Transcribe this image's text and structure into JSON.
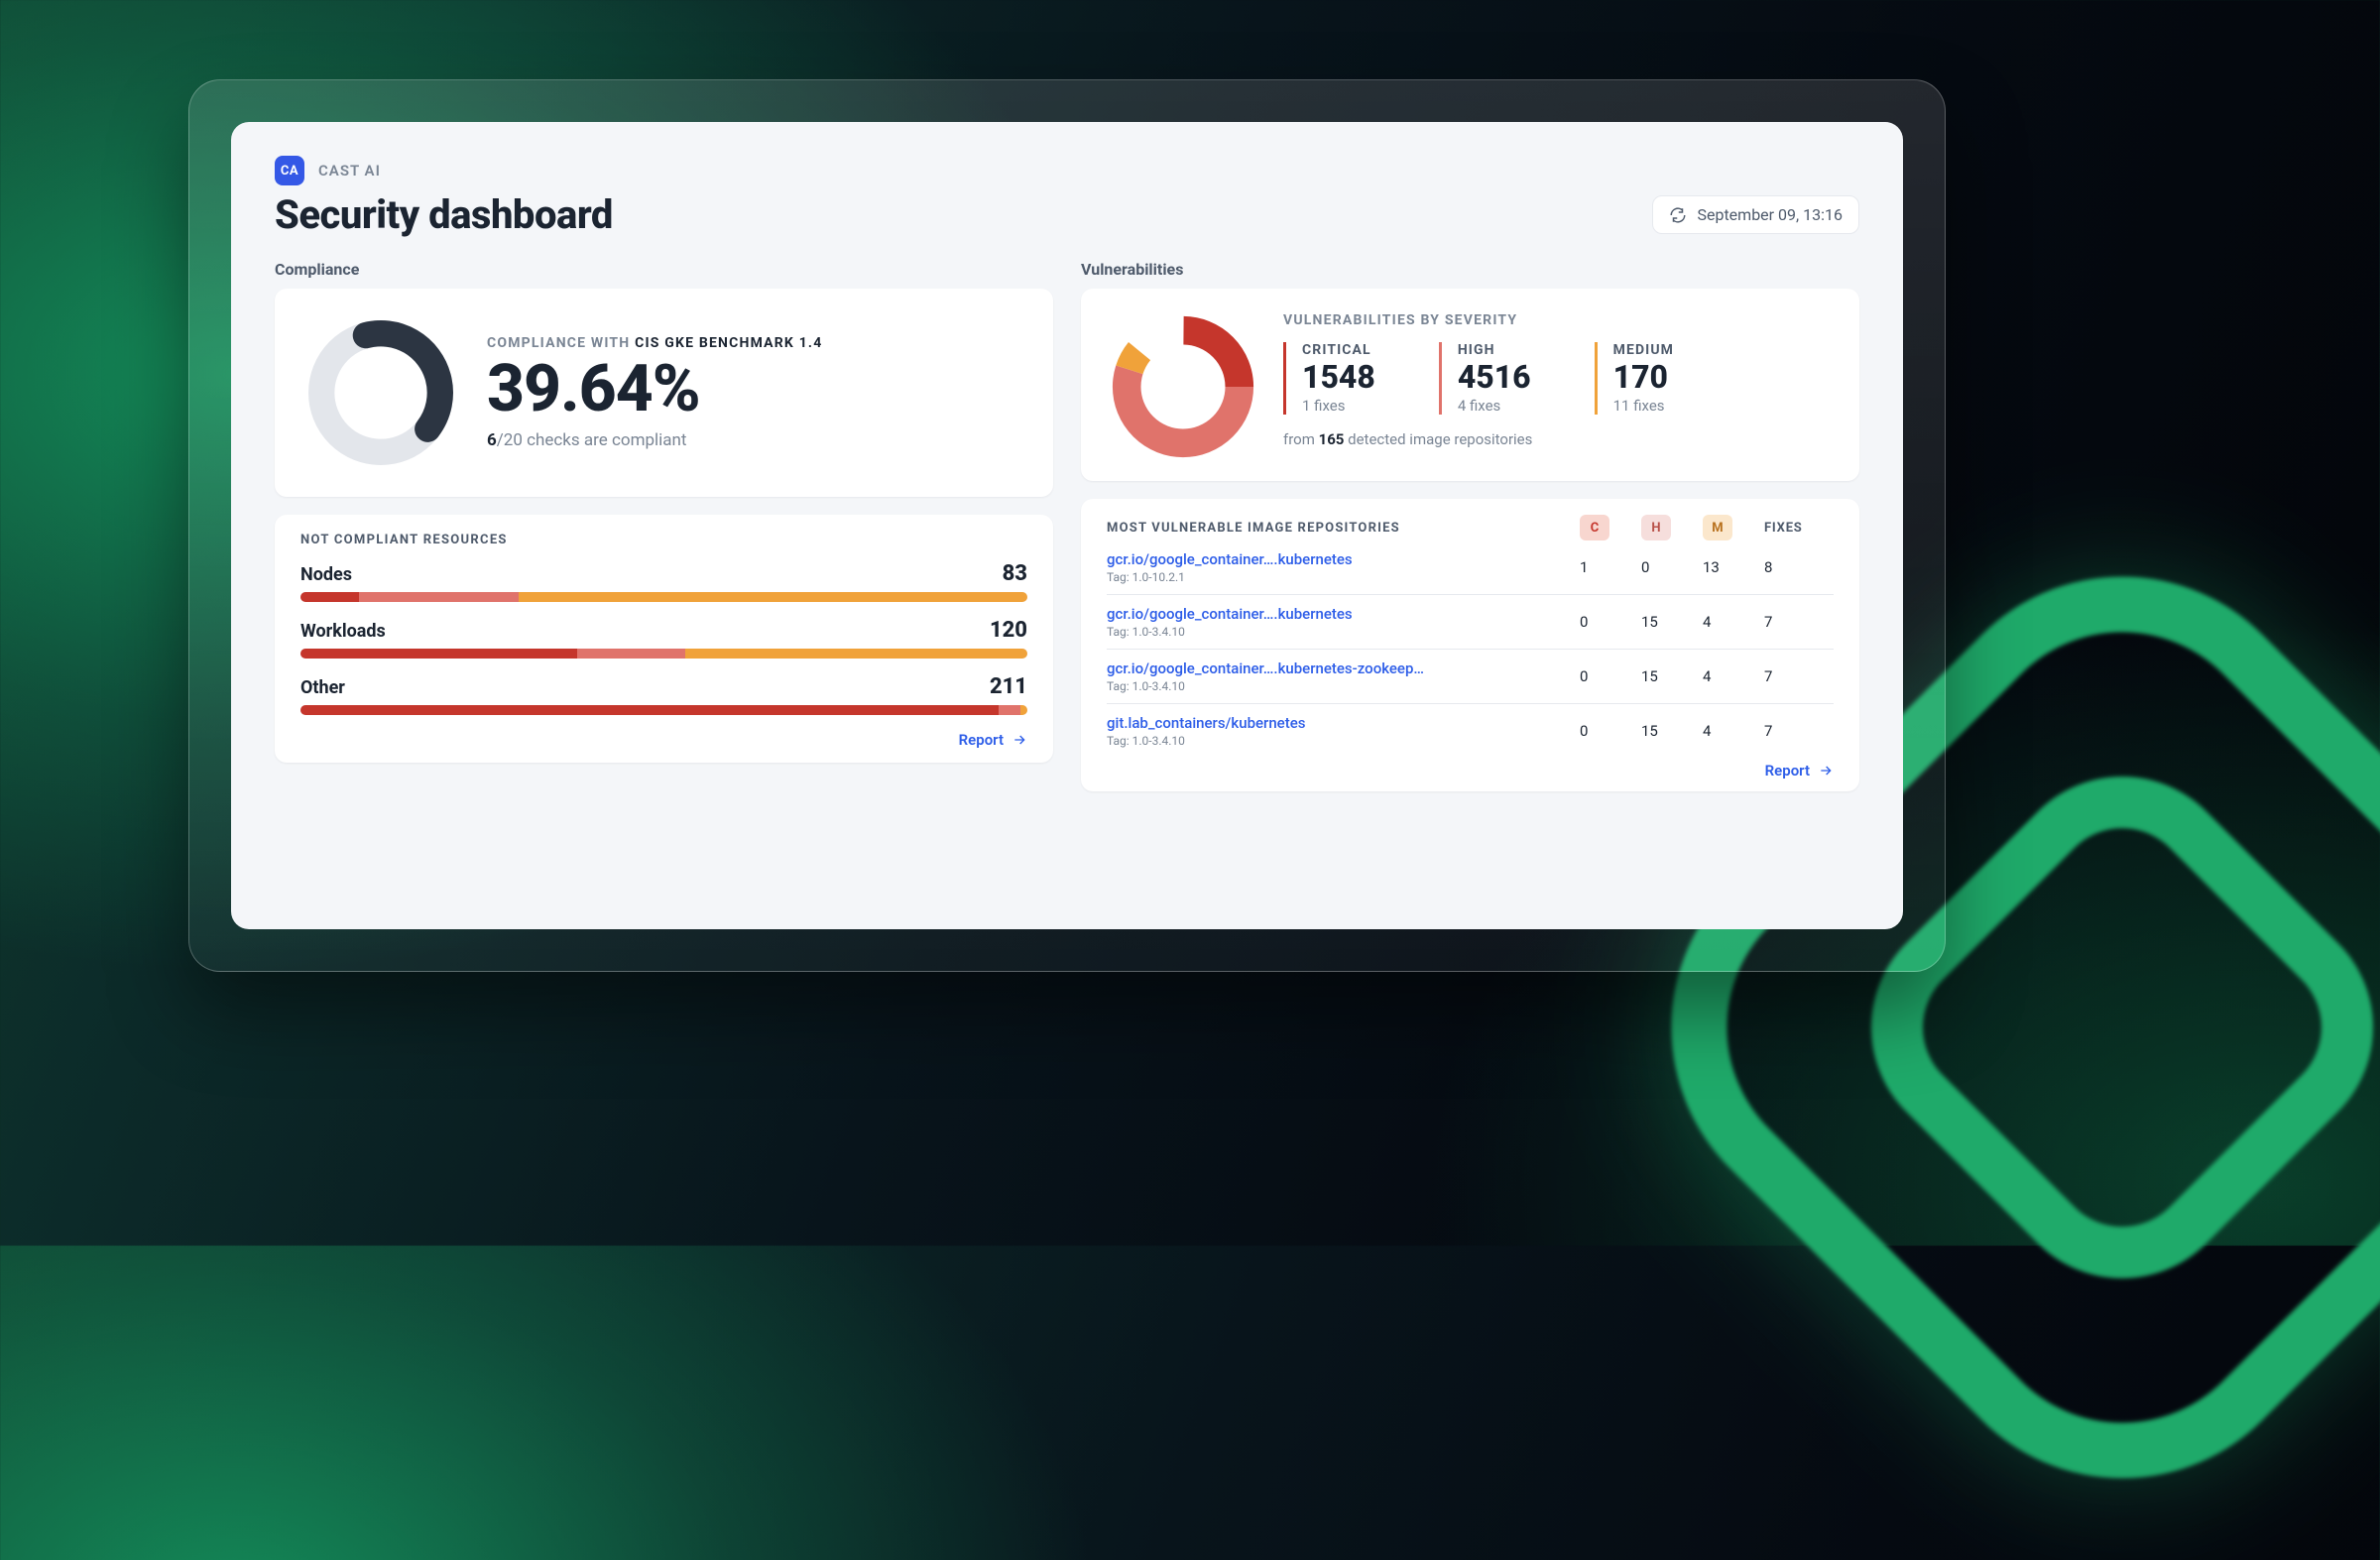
{
  "brand": {
    "badge": "CA",
    "name": "CAST AI"
  },
  "page_title": "Security dashboard",
  "refresh_label": "September 09, 13:16",
  "compliance": {
    "section_label": "Compliance",
    "overline_prefix": "COMPLIANCE WITH ",
    "overline_strong": "CIS GKE BENCHMARK 1.4",
    "percent_text": "39.64%",
    "checks_passed": "6",
    "checks_total": "/20",
    "checks_suffix": " checks are compliant",
    "not_compliant_title": "NOT COMPLIANT RESOURCES",
    "rows": [
      {
        "name": "Nodes",
        "count": "83",
        "crit": 8,
        "high": 22,
        "med": 70
      },
      {
        "name": "Workloads",
        "count": "120",
        "crit": 38,
        "high": 15,
        "med": 47
      },
      {
        "name": "Other",
        "count": "211",
        "crit": 96,
        "high": 3,
        "med": 1
      }
    ],
    "report_label": "Report"
  },
  "vuln": {
    "section_label": "Vulnerabilities",
    "overline": "VULNERABILITIES BY SEVERITY",
    "sev": {
      "critical": {
        "label": "CRITICAL",
        "value": "1548",
        "fixes": "1 fixes"
      },
      "high": {
        "label": "HIGH",
        "value": "4516",
        "fixes": "4 fixes"
      },
      "medium": {
        "label": "MEDIUM",
        "value": "170",
        "fixes": "11 fixes"
      }
    },
    "footer_prefix": "from ",
    "footer_count": "165",
    "footer_suffix": " detected image repositories",
    "table": {
      "title": "MOST VULNERABLE IMAGE REPOSITORIES",
      "badge_c": "C",
      "badge_h": "H",
      "badge_m": "M",
      "fixes_col": "FIXES",
      "rows": [
        {
          "name": "gcr.io/google_container….kubernetes",
          "tag": "Tag: 1.0-10.2.1",
          "c": "1",
          "h": "0",
          "m": "13",
          "f": "8"
        },
        {
          "name": "gcr.io/google_container….kubernetes",
          "tag": "Tag: 1.0-3.4.10",
          "c": "0",
          "h": "15",
          "m": "4",
          "f": "7"
        },
        {
          "name": "gcr.io/google_container….kubernetes-zookeep…",
          "tag": "Tag: 1.0-3.4.10",
          "c": "0",
          "h": "15",
          "m": "4",
          "f": "7"
        },
        {
          "name": "git.lab_containers/kubernetes",
          "tag": "Tag: 1.0-3.4.10",
          "c": "0",
          "h": "15",
          "m": "4",
          "f": "7"
        }
      ]
    },
    "report_label": "Report"
  },
  "chart_data": [
    {
      "type": "pie",
      "title": "Compliance with CIS GKE Benchmark 1.4",
      "categories": [
        "Compliant",
        "Not compliant"
      ],
      "values": [
        39.64,
        60.36
      ],
      "colors": [
        "#2c3542",
        "#e3e6eb"
      ],
      "note": "6/20 checks compliant"
    },
    {
      "type": "pie",
      "title": "Vulnerabilities by severity",
      "categories": [
        "Critical",
        "High",
        "Medium"
      ],
      "values": [
        1548,
        4516,
        170
      ],
      "colors": [
        "#c5362c",
        "#e0736b",
        "#f0a23a"
      ]
    },
    {
      "type": "bar",
      "title": "Not compliant resources",
      "categories": [
        "Nodes",
        "Workloads",
        "Other"
      ],
      "values": [
        83,
        120,
        211
      ]
    }
  ]
}
